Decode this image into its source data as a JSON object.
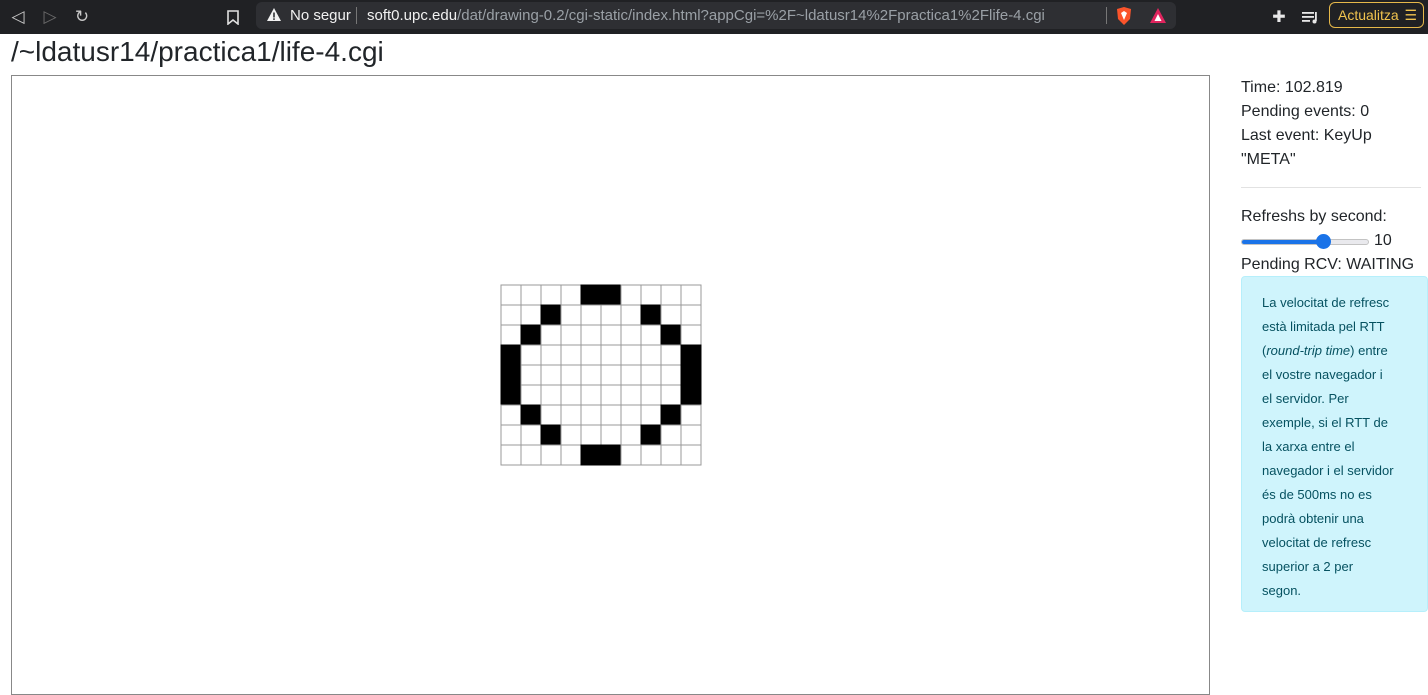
{
  "browser": {
    "not_secure_label": "No segur",
    "url_host": "soft0.upc.edu",
    "url_rest": "/dat/drawing-0.2/cgi-static/index.html?appCgi=%2F~ldatusr14%2Fpractica1%2Flife-4.cgi",
    "update_button_label": "Actualitza"
  },
  "page": {
    "title": "/~ldatusr14/practica1/life-4.cgi"
  },
  "sidebar": {
    "time": "Time: 102.819",
    "pending_events": "Pending events: 0",
    "last_event_line1": "Last event: KeyUp",
    "last_event_line2": "\"META\"",
    "refresh_label": "Refreshs by second:",
    "refresh_value": "10",
    "refresh_fraction": 0.65,
    "pending_rcv": "Pending RCV: WAITING",
    "info_lines": [
      "La velocitat de refresc",
      "està limitada pel RTT",
      "(round-trip time) entre",
      "el vostre navegador i",
      "el servidor. Per",
      "exemple, si el RTT de",
      "la xarxa entre el",
      "navegador i el servidor",
      "és de 500ms no es",
      "podrà obtenir una",
      "velocitat de refresc",
      "superior a 2 per",
      "segon."
    ]
  },
  "life_grid": {
    "rows": 9,
    "cols": 10,
    "alive": [
      [
        0,
        4
      ],
      [
        0,
        5
      ],
      [
        1,
        2
      ],
      [
        1,
        7
      ],
      [
        2,
        1
      ],
      [
        2,
        8
      ],
      [
        3,
        0
      ],
      [
        3,
        9
      ],
      [
        4,
        0
      ],
      [
        4,
        9
      ],
      [
        5,
        0
      ],
      [
        5,
        9
      ],
      [
        6,
        1
      ],
      [
        6,
        8
      ],
      [
        7,
        2
      ],
      [
        7,
        7
      ],
      [
        8,
        4
      ],
      [
        8,
        5
      ]
    ]
  }
}
